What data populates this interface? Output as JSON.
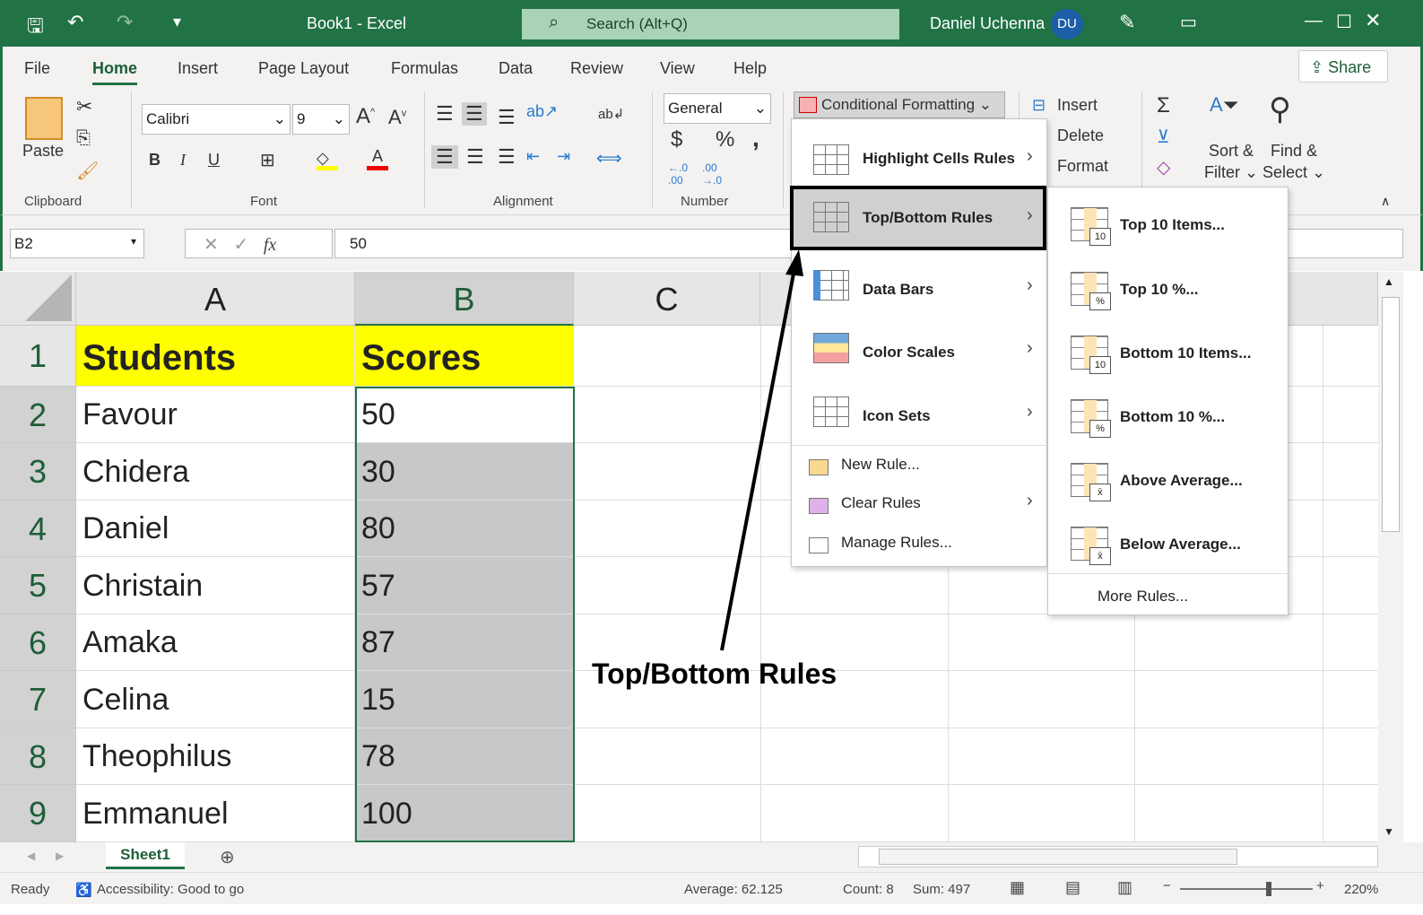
{
  "titlebar": {
    "doc_title": "Book1  -  Excel",
    "search_placeholder": "Search (Alt+Q)",
    "user_name": "Daniel Uchenna",
    "user_initials": "DU"
  },
  "menu": {
    "tabs": [
      "File",
      "Home",
      "Insert",
      "Page Layout",
      "Formulas",
      "Data",
      "Review",
      "View",
      "Help"
    ],
    "active": "Home",
    "share": "Share"
  },
  "ribbon": {
    "clipboard": {
      "label": "Clipboard",
      "paste": "Paste"
    },
    "font": {
      "label": "Font",
      "font_name": "Calibri",
      "font_size": "9",
      "bold": "B",
      "italic": "I",
      "underline": "U"
    },
    "alignment": {
      "label": "Alignment"
    },
    "number": {
      "label": "Number",
      "format": "General",
      "currency": "$",
      "percent": "%",
      "comma": ","
    },
    "styles": {
      "conditional_formatting": "Conditional Formatting"
    },
    "cells": {
      "insert": "Insert",
      "delete": "Delete",
      "format": "Format"
    },
    "editing": {
      "sort_filter_1": "Sort &",
      "sort_filter_2": "Filter",
      "find_select_1": "Find &",
      "find_select_2": "Select",
      "sum": "Σ"
    }
  },
  "formula_bar": {
    "name_box": "B2",
    "fx": "fx",
    "value": "50"
  },
  "sheet": {
    "columns": [
      "A",
      "B",
      "C"
    ],
    "rows": [
      "1",
      "2",
      "3",
      "4",
      "5",
      "6",
      "7",
      "8",
      "9"
    ],
    "headers": [
      "Students",
      "Scores"
    ],
    "data": [
      [
        "Favour",
        "50"
      ],
      [
        "Chidera",
        "30"
      ],
      [
        "Daniel",
        "80"
      ],
      [
        "Christain",
        "57"
      ],
      [
        "Amaka",
        "87"
      ],
      [
        "Celina",
        "15"
      ],
      [
        "Theophilus",
        "78"
      ],
      [
        "Emmanuel",
        "100"
      ]
    ],
    "header_fill": "#ffff00"
  },
  "dropdown": {
    "items": [
      "Highlight Cells Rules",
      "Top/Bottom Rules",
      "Data Bars",
      "Color Scales",
      "Icon Sets"
    ],
    "actions": [
      "New Rule...",
      "Clear Rules",
      "Manage Rules..."
    ],
    "highlighted": "Top/Bottom Rules"
  },
  "submenu": {
    "items": [
      {
        "label": "Top 10 Items...",
        "badge": "10"
      },
      {
        "label": "Top 10 %...",
        "badge": "%"
      },
      {
        "label": "Bottom 10 Items...",
        "badge": "10"
      },
      {
        "label": "Bottom 10 %...",
        "badge": "%"
      },
      {
        "label": "Above Average...",
        "badge": "x̄"
      },
      {
        "label": "Below Average...",
        "badge": "x̄"
      }
    ],
    "more": "More Rules..."
  },
  "annotation": "Top/Bottom Rules",
  "sheet_tabs": [
    "Sheet1"
  ],
  "status": {
    "ready": "Ready",
    "accessibility": "Accessibility: Good to go",
    "average": "Average: 62.125",
    "count": "Count: 8",
    "sum": "Sum: 497",
    "zoom": "220%"
  }
}
